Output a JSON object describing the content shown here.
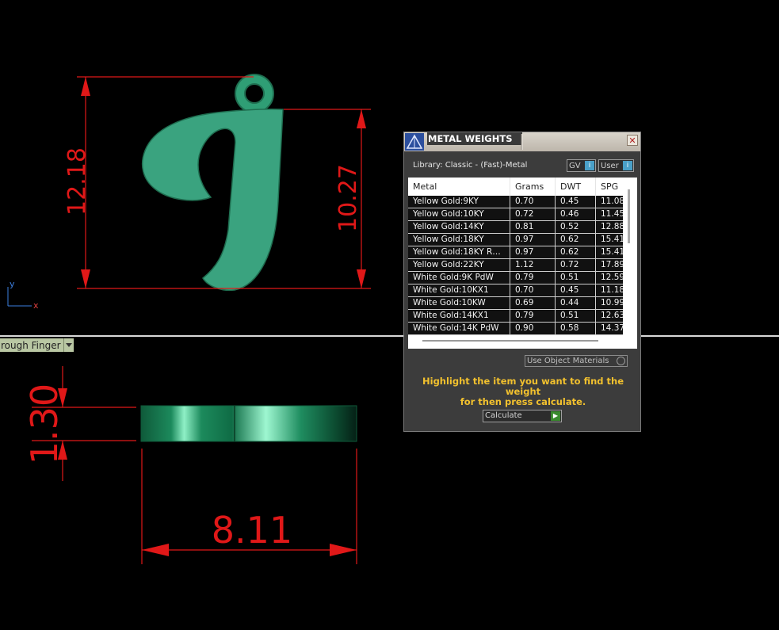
{
  "viewport": {
    "dimensions": [
      "12.18",
      "10.27",
      "1.30",
      "8.11"
    ],
    "axis_labels": {
      "y": "y",
      "x": "x"
    },
    "view_dropdown": "rough Finger",
    "colors": {
      "dimension": "#e01818",
      "model": "#3aa37f"
    }
  },
  "panel": {
    "title": "METAL WEIGHTS",
    "close_label": "✕",
    "library_label": "Library: Classic - (Fast)-Metal",
    "gv_button": "GV",
    "user_button": "User",
    "table": {
      "headers": [
        "Metal",
        "Grams",
        "DWT",
        "SPG"
      ],
      "rows": [
        [
          "Yellow Gold:9KY",
          "0.70",
          "0.45",
          "11.08"
        ],
        [
          "Yellow Gold:10KY",
          "0.72",
          "0.46",
          "11.45"
        ],
        [
          "Yellow Gold:14KY",
          "0.81",
          "0.52",
          "12.88"
        ],
        [
          "Yellow Gold:18KY",
          "0.97",
          "0.62",
          "15.41"
        ],
        [
          "Yellow Gold:18KY R…",
          "0.97",
          "0.62",
          "15.41"
        ],
        [
          "Yellow Gold:22KY",
          "1.12",
          "0.72",
          "17.89"
        ],
        [
          "White Gold:9K PdW",
          "0.79",
          "0.51",
          "12.59"
        ],
        [
          "White Gold:10KX1",
          "0.70",
          "0.45",
          "11.18"
        ],
        [
          "White Gold:10KW",
          "0.69",
          "0.44",
          "10.99"
        ],
        [
          "White Gold:14KX1",
          "0.79",
          "0.51",
          "12.63"
        ],
        [
          "White Gold:14K PdW",
          "0.90",
          "0.58",
          "14.37"
        ]
      ]
    },
    "use_object_materials": "Use Object Materials",
    "hint_line1": "Highlight the item you want to find the weight",
    "hint_line2": "for then press calculate.",
    "calculate_label": "Calculate"
  }
}
